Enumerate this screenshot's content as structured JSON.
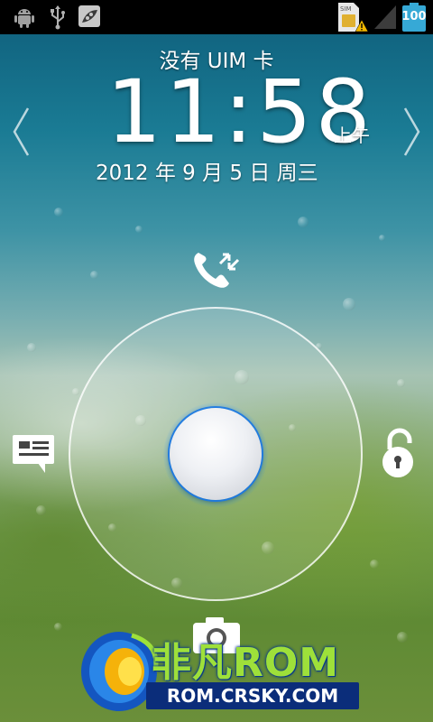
{
  "status_bar": {
    "icons": [
      "android-debug-icon",
      "usb-icon",
      "pea-pod-app-icon",
      "sim-warning-icon",
      "signal-icon",
      "battery-icon"
    ],
    "battery_level": "100",
    "sim_label": "SIM"
  },
  "lockscreen": {
    "carrier": "没有 UIM 卡",
    "time": "11:58",
    "ampm": "上午",
    "date": "2012 年 9 月 5 日 周三"
  },
  "unlock_targets": {
    "top": "phone-call-icon",
    "left": "message-icon",
    "right": "unlock-icon",
    "bottom": "camera-icon"
  },
  "watermark": {
    "name": "非凡ROM",
    "url": "ROM.CRSKY.COM"
  },
  "colors": {
    "handle_glow": "#2896ff",
    "watermark_green": "#9ee03a",
    "watermark_blue": "#0b2d7a",
    "battery": "#36a9d6"
  }
}
